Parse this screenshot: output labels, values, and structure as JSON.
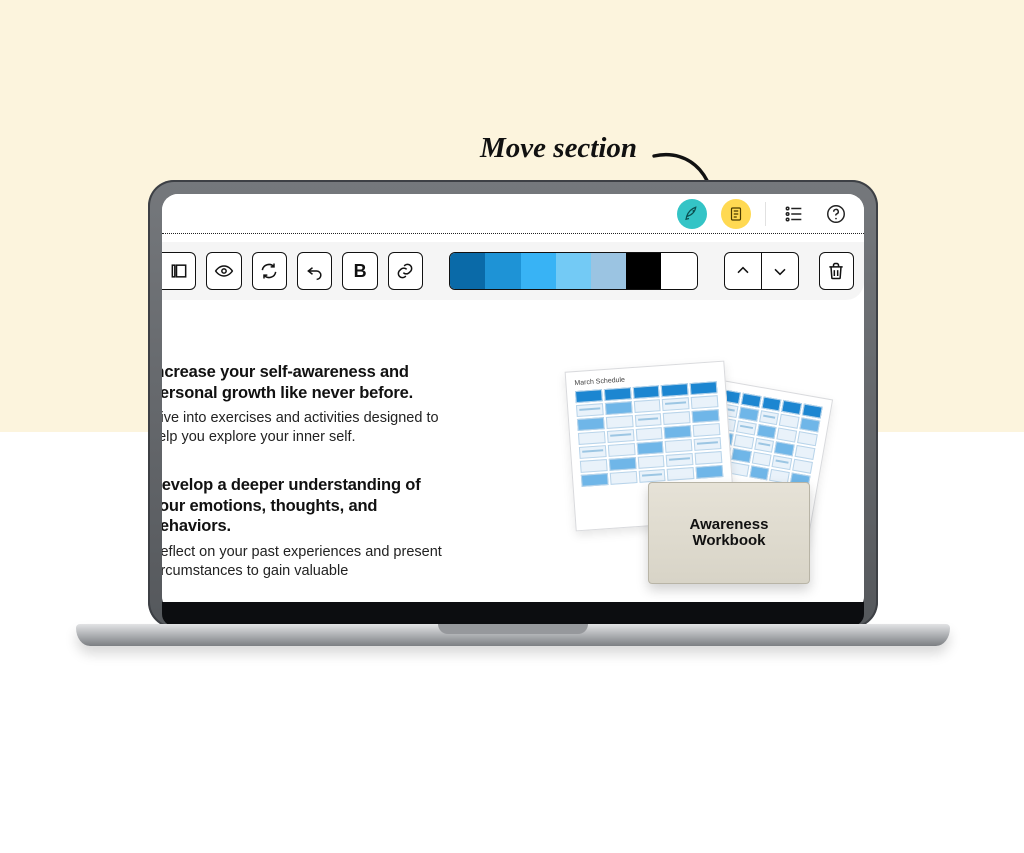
{
  "annotation": {
    "text": "Move section"
  },
  "topbar": {
    "icons": {
      "rocket": "rocket-icon",
      "page": "page-icon",
      "list": "list-icon",
      "help": "help-icon"
    }
  },
  "toolbar": {
    "buttons": {
      "leftbar": "leftbar",
      "preview": "preview",
      "refresh": "refresh",
      "undo": "undo",
      "bold_label": "B",
      "link": "link",
      "move_up": "move-up",
      "move_down": "move-down",
      "trash": "trash"
    },
    "swatches": [
      "#0a6aa8",
      "#1e93d6",
      "#38b3f5",
      "#73caf5",
      "#9bc4e2",
      "#000000",
      "#ffffff"
    ]
  },
  "content": {
    "blocks": [
      {
        "heading": "Increase your self-awareness and personal growth like never before.",
        "body": "Dive into exercises and activities designed to help you explore your inner self."
      },
      {
        "heading": "Develop a deeper understanding of your emotions, thoughts, and behaviors.",
        "body": "Reflect on your past experiences and present circumstances to gain valuable"
      }
    ],
    "illustration": {
      "sheet_title": "March Schedule",
      "workbook_title_line1": "Awareness",
      "workbook_title_line2": "Workbook"
    }
  }
}
